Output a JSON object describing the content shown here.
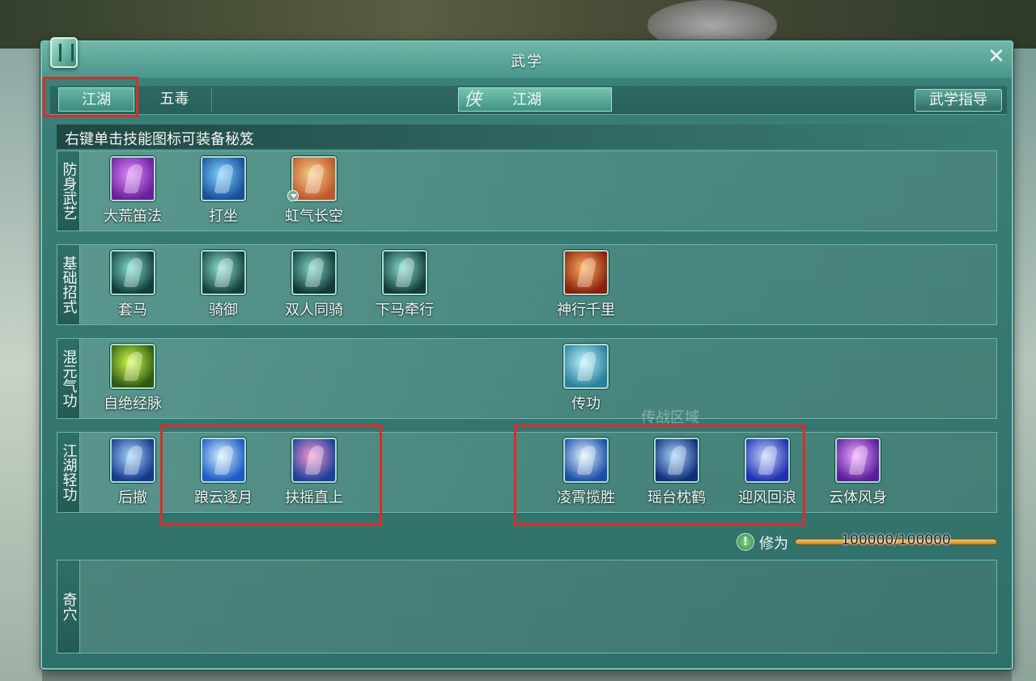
{
  "window": {
    "title": "武学"
  },
  "tabs": {
    "jianghu": "江湖",
    "wudu": "五毒"
  },
  "center_tab": {
    "emblem": "侠",
    "label": "江湖"
  },
  "guide_button": "武学指导",
  "hint": "右键单击技能图标可装备秘笈",
  "sections": {
    "fangshen": {
      "label": "防身武艺",
      "skills": [
        {
          "name": "大荒笛法",
          "color_a": "#e08cff",
          "color_b": "#6b1f9c"
        },
        {
          "name": "打坐",
          "color_a": "#7fd7ff",
          "color_b": "#1a4e9c"
        },
        {
          "name": "虹气长空",
          "color_a": "#f6d28a",
          "color_b": "#c2562a"
        }
      ]
    },
    "jichu": {
      "label": "基础招式",
      "skills": [
        {
          "name": "套马",
          "color_a": "#7fe0d0",
          "color_b": "#123c3a"
        },
        {
          "name": "骑御",
          "color_a": "#8fe6d6",
          "color_b": "#15403d"
        },
        {
          "name": "双人同骑",
          "color_a": "#7fd8c8",
          "color_b": "#103836"
        },
        {
          "name": "下马牵行",
          "color_a": "#86dfcf",
          "color_b": "#123b39"
        },
        {
          "name": "神行千里",
          "color_a": "#ffb05a",
          "color_b": "#8a1f0e"
        }
      ]
    },
    "hunyuan": {
      "label": "混元气功",
      "skills": [
        {
          "name": "自绝经脉",
          "color_a": "#d6ff4a",
          "color_b": "#2e5a12"
        },
        {
          "name": "传功",
          "color_a": "#bff4ff",
          "color_b": "#2a7f9c"
        }
      ]
    },
    "qinggong": {
      "label": "江湖轻功",
      "skills": [
        {
          "name": "后撤",
          "color_a": "#a6d6ff",
          "color_b": "#16398c"
        },
        {
          "name": "踉云逐月",
          "color_a": "#d6f4ff",
          "color_b": "#1c5ac6"
        },
        {
          "name": "扶摇直上",
          "color_a": "#ff9ad0",
          "color_b": "#1c3f9c"
        },
        {
          "name": "凌霄揽胜",
          "color_a": "#e6f6ff",
          "color_b": "#1a4fa8"
        },
        {
          "name": "瑶台枕鹤",
          "color_a": "#a9d6ff",
          "color_b": "#122e7a"
        },
        {
          "name": "迎风回浪",
          "color_a": "#c6d6ff",
          "color_b": "#2030b0"
        },
        {
          "name": "云体风身",
          "color_a": "#f0a8ff",
          "color_b": "#5a1c9c"
        }
      ]
    }
  },
  "ghost_text": "传战区域",
  "xiuwei": {
    "icon": "!",
    "label": "修为",
    "value": "100000/100000",
    "fraction": 1.0
  },
  "qixue": {
    "label": "奇穴"
  }
}
